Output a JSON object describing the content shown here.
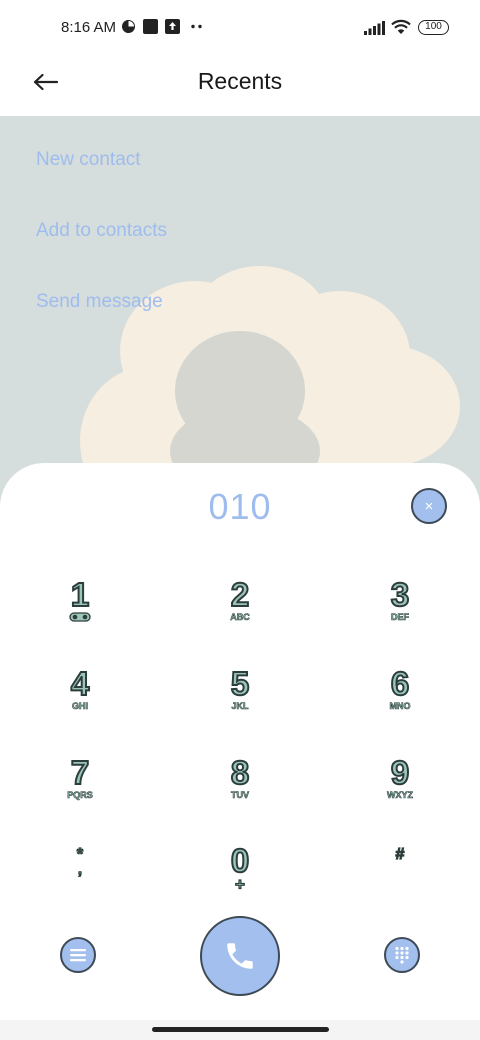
{
  "status_bar": {
    "time": "8:16 AM",
    "battery": "100",
    "icons": [
      "pie-status-icon",
      "square-status-icon",
      "upload-status-icon",
      "more-dots-icon",
      "signal-icon",
      "wifi-icon",
      "battery-icon"
    ]
  },
  "header": {
    "title": "Recents",
    "back_icon": "back-arrow-icon"
  },
  "actions": [
    {
      "label": "New contact"
    },
    {
      "label": "Add to contacts"
    },
    {
      "label": "Send message"
    }
  ],
  "dialer": {
    "number": "010",
    "clear_icon": "×",
    "keys": [
      {
        "digit": "1",
        "sub": "voicemail"
      },
      {
        "digit": "2",
        "sub": "ABC"
      },
      {
        "digit": "3",
        "sub": "DEF"
      },
      {
        "digit": "4",
        "sub": "GHI"
      },
      {
        "digit": "5",
        "sub": "JKL"
      },
      {
        "digit": "6",
        "sub": "MNO"
      },
      {
        "digit": "7",
        "sub": "PQRS"
      },
      {
        "digit": "8",
        "sub": "TUV"
      },
      {
        "digit": "9",
        "sub": "WXYZ"
      },
      {
        "digit": "*",
        "sub": ","
      },
      {
        "digit": "0",
        "sub": "+"
      },
      {
        "digit": "#",
        "sub": ""
      }
    ]
  },
  "colors": {
    "accent": "#9fbcee",
    "key_fill": "#9cc4b8",
    "key_stroke": "#2c3e3c",
    "wallpaper": "#d6dedd"
  }
}
